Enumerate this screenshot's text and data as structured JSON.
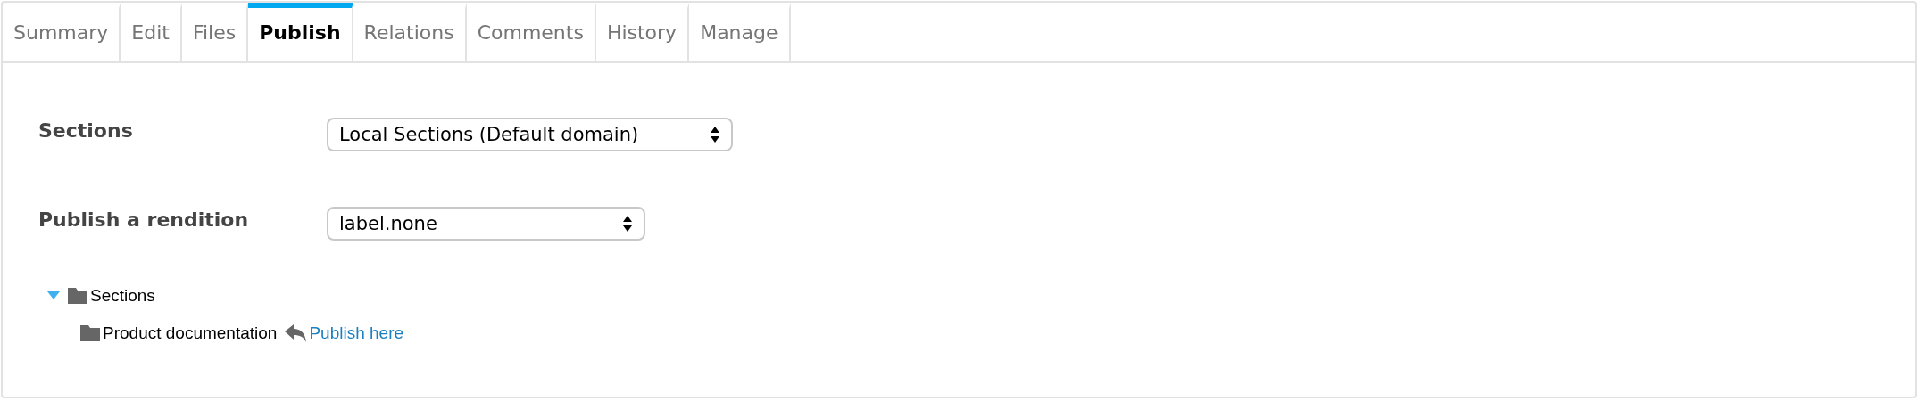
{
  "tabs": [
    {
      "label": "Summary",
      "selected": false
    },
    {
      "label": "Edit",
      "selected": false
    },
    {
      "label": "Files",
      "selected": false
    },
    {
      "label": "Publish",
      "selected": true
    },
    {
      "label": "Relations",
      "selected": false
    },
    {
      "label": "Comments",
      "selected": false
    },
    {
      "label": "History",
      "selected": false
    },
    {
      "label": "Manage",
      "selected": false
    }
  ],
  "form": [
    {
      "label": "Sections",
      "value": "Local Sections (Default domain)"
    },
    {
      "label": "Publish a rendition",
      "value": "label.none"
    }
  ],
  "tree": [
    {
      "label": "Sections",
      "expanded": true,
      "children": [
        {
          "label": "Product documentation",
          "action": "Publish here"
        }
      ]
    }
  ]
}
